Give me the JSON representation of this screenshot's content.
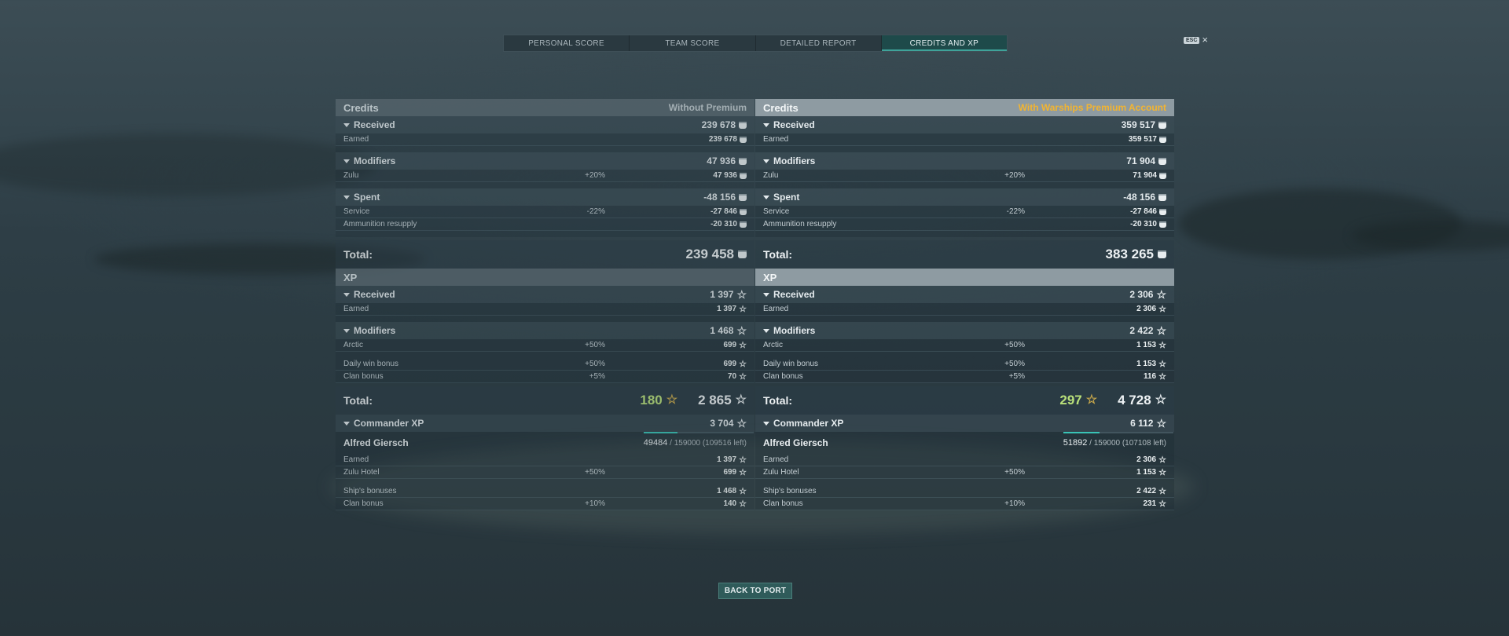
{
  "tabs": [
    "PERSONAL SCORE",
    "TEAM SCORE",
    "DETAILED REPORT",
    "CREDITS AND XP"
  ],
  "esc_label": "ESC",
  "back_label": "BACK TO PORT",
  "accent_colors": {
    "premium": "#f2b431",
    "green_xp": "#b9e07a",
    "teal": "#39c3b6"
  },
  "left": {
    "credits_title": "Credits",
    "credits_note": "Without Premium",
    "received": {
      "label": "Received",
      "value": "239 678",
      "rows": [
        {
          "label": "Earned",
          "value": "239 678"
        }
      ]
    },
    "modifiers": {
      "label": "Modifiers",
      "value": "47 936",
      "rows": [
        {
          "label": "Zulu",
          "pct": "+20%",
          "value": "47 936"
        }
      ]
    },
    "spent": {
      "label": "Spent",
      "value": "-48 156",
      "rows": [
        {
          "label": "Service",
          "pct": "-22%",
          "value": "-27 846"
        },
        {
          "label": "Ammunition resupply",
          "pct": "",
          "value": "-20 310"
        }
      ]
    },
    "credits_total_label": "Total:",
    "credits_total": "239 458",
    "xp_title": "XP",
    "xp_received": {
      "label": "Received",
      "value": "1 397",
      "rows": [
        {
          "label": "Earned",
          "value": "1 397"
        }
      ]
    },
    "xp_modifiers": {
      "label": "Modifiers",
      "value": "1 468",
      "rows": [
        {
          "label": "Arctic",
          "pct": "+50%",
          "value": "699"
        },
        {
          "label": "Daily win bonus",
          "pct": "+50%",
          "value": "699"
        },
        {
          "label": "Clan bonus",
          "pct": "+5%",
          "value": "70"
        }
      ]
    },
    "xp_total_label": "Total:",
    "xp_total_free": "180",
    "xp_total": "2 865",
    "cmdr": {
      "label": "Commander XP",
      "value": "3 704",
      "name": "Alfred Giersch",
      "progress_current": "49484",
      "progress_rest": "/ 159000 (109516 left)",
      "progress_fraction": 0.31,
      "rows": [
        {
          "label": "Earned",
          "pct": "",
          "value": "1 397"
        },
        {
          "label": "Zulu Hotel",
          "pct": "+50%",
          "value": "699"
        },
        {
          "label": "Ship's bonuses",
          "pct": "",
          "value": "1 468"
        },
        {
          "label": "Clan bonus",
          "pct": "+10%",
          "value": "140"
        }
      ]
    }
  },
  "right": {
    "credits_title": "Credits",
    "credits_note": "With Warships Premium Account",
    "received": {
      "label": "Received",
      "value": "359 517",
      "rows": [
        {
          "label": "Earned",
          "value": "359 517"
        }
      ]
    },
    "modifiers": {
      "label": "Modifiers",
      "value": "71 904",
      "rows": [
        {
          "label": "Zulu",
          "pct": "+20%",
          "value": "71 904"
        }
      ]
    },
    "spent": {
      "label": "Spent",
      "value": "-48 156",
      "rows": [
        {
          "label": "Service",
          "pct": "-22%",
          "value": "-27 846"
        },
        {
          "label": "Ammunition resupply",
          "pct": "",
          "value": "-20 310"
        }
      ]
    },
    "credits_total_label": "Total:",
    "credits_total": "383 265",
    "xp_title": "XP",
    "xp_received": {
      "label": "Received",
      "value": "2 306",
      "rows": [
        {
          "label": "Earned",
          "value": "2 306"
        }
      ]
    },
    "xp_modifiers": {
      "label": "Modifiers",
      "value": "2 422",
      "rows": [
        {
          "label": "Arctic",
          "pct": "+50%",
          "value": "1 153"
        },
        {
          "label": "Daily win bonus",
          "pct": "+50%",
          "value": "1 153"
        },
        {
          "label": "Clan bonus",
          "pct": "+5%",
          "value": "116"
        }
      ]
    },
    "xp_total_label": "Total:",
    "xp_total_free": "297",
    "xp_total": "4 728",
    "cmdr": {
      "label": "Commander XP",
      "value": "6 112",
      "name": "Alfred Giersch",
      "progress_current": "51892",
      "progress_rest": "/ 159000 (107108 left)",
      "progress_fraction": 0.33,
      "rows": [
        {
          "label": "Earned",
          "pct": "",
          "value": "2 306"
        },
        {
          "label": "Zulu Hotel",
          "pct": "+50%",
          "value": "1 153"
        },
        {
          "label": "Ship's bonuses",
          "pct": "",
          "value": "2 422"
        },
        {
          "label": "Clan bonus",
          "pct": "+10%",
          "value": "231"
        }
      ]
    }
  }
}
